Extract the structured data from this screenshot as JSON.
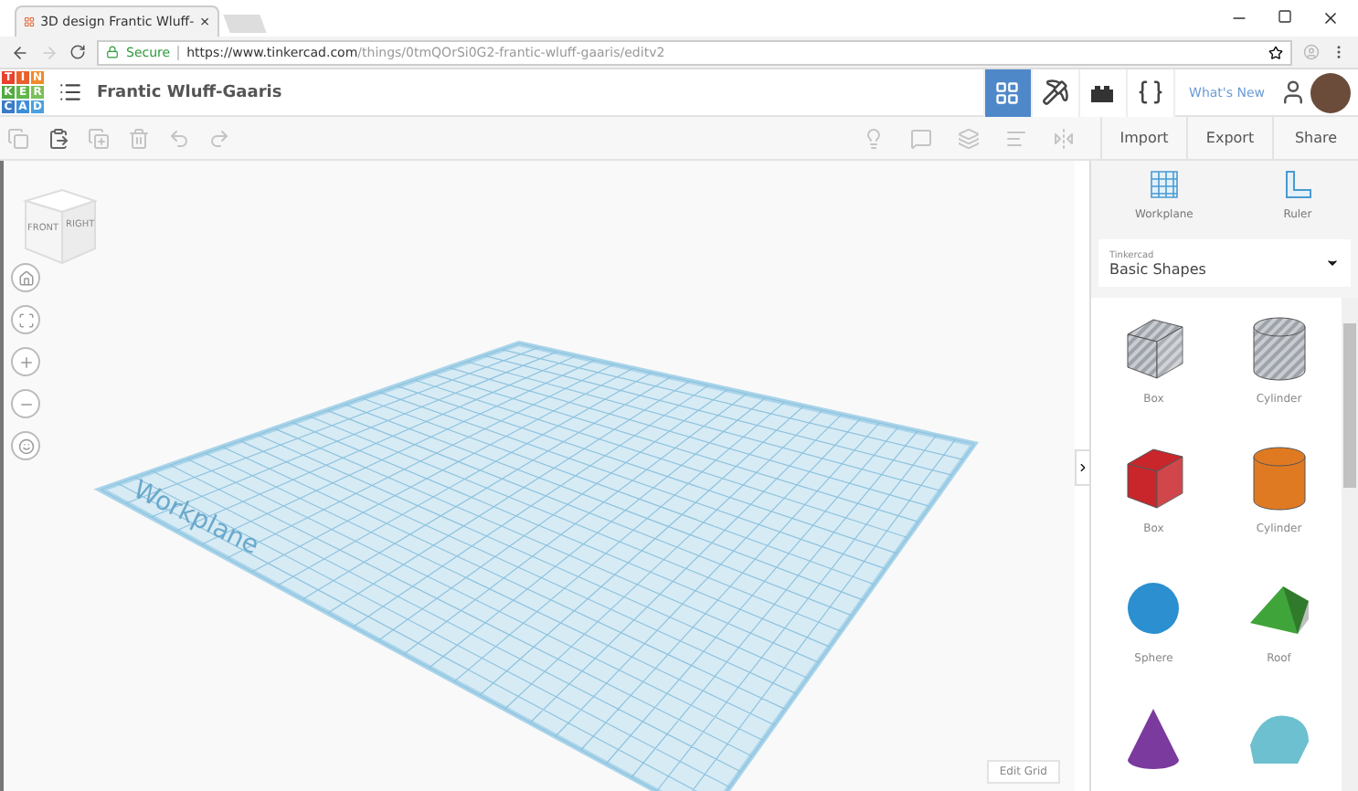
{
  "browser": {
    "tab_title": "3D design Frantic Wluff-",
    "tab_close": "×",
    "secure_label": "Secure",
    "url_host": "https://www.tinkercad.com",
    "url_path": "/things/0tmQOrSi0G2-frantic-wluff-gaaris/editv2"
  },
  "header": {
    "logo_letters": [
      "T",
      "I",
      "N",
      "K",
      "E",
      "R",
      "C",
      "A",
      "D"
    ],
    "design_title": "Frantic Wluff-Gaaris",
    "whats_new": "What's New",
    "view_modes": [
      {
        "kind": "grid",
        "selected": true
      },
      {
        "kind": "pickaxe",
        "selected": false
      },
      {
        "kind": "bricks",
        "selected": false
      },
      {
        "kind": "codeblocks",
        "selected": false
      }
    ]
  },
  "toolbar": {
    "actions": [
      "Import",
      "Export",
      "Share"
    ]
  },
  "view_cube": {
    "front": "FRONT",
    "right": "RIGHT"
  },
  "workplane": {
    "label": "Workplane",
    "edit_grid": "Edit Grid"
  },
  "sidebar": {
    "tools": [
      {
        "kind": "workplane",
        "label": "Workplane"
      },
      {
        "kind": "ruler",
        "label": "Ruler"
      }
    ],
    "library": {
      "source": "Tinkercad",
      "category": "Basic Shapes"
    },
    "shapes": [
      {
        "kind": "box",
        "striped": true,
        "color": "#b8bcc2",
        "label": "Box"
      },
      {
        "kind": "cylinder",
        "striped": true,
        "color": "#b8bcc2",
        "label": "Cylinder"
      },
      {
        "kind": "box",
        "striped": false,
        "color": "#c8262b",
        "label": "Box"
      },
      {
        "kind": "cylinder",
        "striped": false,
        "color": "#e07a22",
        "label": "Cylinder"
      },
      {
        "kind": "sphere",
        "striped": false,
        "color": "#2b8fd0",
        "label": "Sphere"
      },
      {
        "kind": "roof",
        "striped": false,
        "color": "#3fa53a",
        "label": "Roof"
      },
      {
        "kind": "cone",
        "striped": false,
        "color": "#7a3a9e"
      },
      {
        "kind": "half-cylinder",
        "striped": false,
        "color": "#6cc0d0"
      }
    ]
  }
}
